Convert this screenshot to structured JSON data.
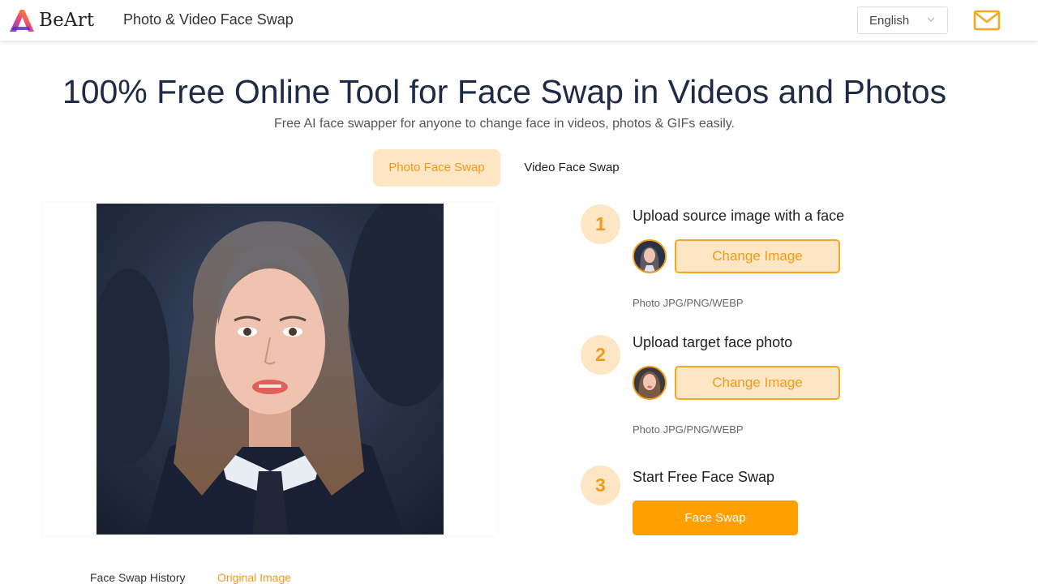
{
  "header": {
    "brand": "BeArt",
    "nav_title": "Photo & Video Face Swap",
    "language": "English",
    "icons": {
      "logo": "beart-logo-icon",
      "mail": "mail-icon",
      "chevron": "chevron-down-icon"
    }
  },
  "hero": {
    "title": "100% Free Online Tool for Face Swap in Videos and Photos",
    "subtitle": "Free AI face swapper for anyone to change face in videos, photos & GIFs easily."
  },
  "tabs": [
    {
      "label": "Photo Face Swap",
      "active": true
    },
    {
      "label": "Video Face Swap",
      "active": false
    }
  ],
  "steps": [
    {
      "number": "1",
      "title": "Upload source image with a face",
      "button": "Change Image",
      "note": "Photo JPG/PNG/WEBP"
    },
    {
      "number": "2",
      "title": "Upload target face photo",
      "button": "Change Image",
      "note": "Photo JPG/PNG/WEBP"
    },
    {
      "number": "3",
      "title": "Start Free Face Swap",
      "button": "Face Swap"
    }
  ],
  "bottom": {
    "history": "Face Swap History",
    "original": "Original Image"
  },
  "colors": {
    "accent": "#ff9f00",
    "accent_light": "#fde6c3",
    "accent_text": "#f29a1b",
    "title": "#1f2a44"
  }
}
